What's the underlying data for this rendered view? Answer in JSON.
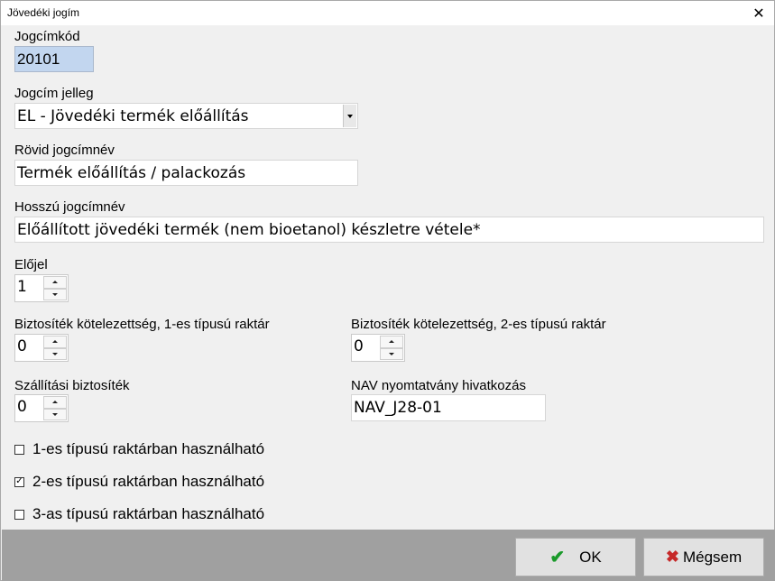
{
  "window": {
    "title": "Jövedéki jogím",
    "close_glyph": "✕"
  },
  "form": {
    "code": {
      "label": "Jogcímkód",
      "value": "20101"
    },
    "type": {
      "label": "Jogcím jelleg",
      "value": "EL - Jövedéki termék előállítás"
    },
    "short_name": {
      "label": "Rövid jogcímnév",
      "value": "Termék előállítás / palackozás"
    },
    "long_name": {
      "label": "Hosszú jogcímnév",
      "value": "Előállított jövedéki termék (nem bioetanol) készletre vétele*"
    },
    "sign": {
      "label": "Előjel",
      "value": "1"
    },
    "guarantee_type1": {
      "label": "Biztosíték kötelezettség, 1-es típusú raktár",
      "value": "0"
    },
    "guarantee_type2": {
      "label": "Biztosíték kötelezettség, 2-es típusú raktár",
      "value": "0"
    },
    "transport_guarantee": {
      "label": "Szállítási biztosíték",
      "value": "0"
    },
    "nav_ref": {
      "label": "NAV nyomtatvány hivatkozás",
      "value": "NAV_J28-01"
    },
    "checkboxes": [
      {
        "label": "1-es típusú raktárban használható",
        "checked": false
      },
      {
        "label": "2-es típusú raktárban használható",
        "checked": true
      },
      {
        "label": "3-as típusú raktárban használható",
        "checked": false
      }
    ]
  },
  "buttons": {
    "ok": {
      "label": "OK",
      "icon": "checkmark-icon"
    },
    "cancel": {
      "label": "Mégsem",
      "icon": "x-icon"
    }
  },
  "colors": {
    "footer": "#a0a0a0",
    "code_field_bg": "#c2d6ef",
    "ok_icon": "#1a9a2a",
    "cancel_icon": "#c62828"
  }
}
